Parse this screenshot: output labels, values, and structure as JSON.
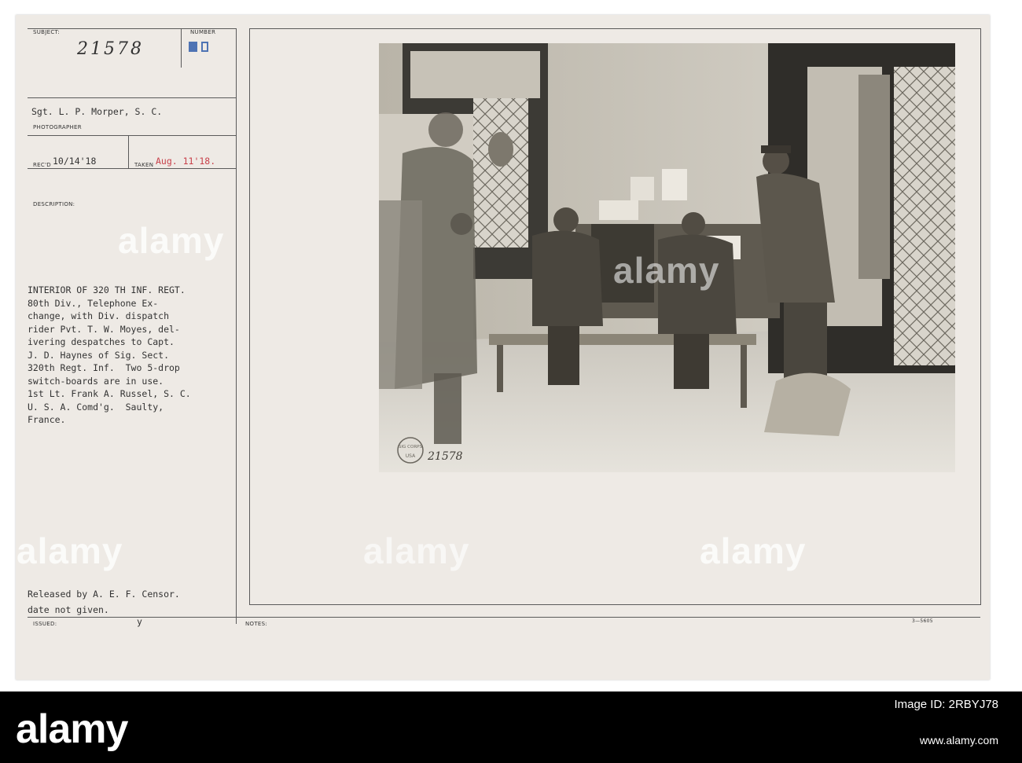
{
  "card": {
    "subject_label": "SUBJECT:",
    "number_label": "NUMBER",
    "number_value": "21578",
    "photographer": "Sgt. L. P. Morper, S. C.",
    "photographer_label": "PHOTOGRAPHER",
    "recd_label": "REC'D",
    "recd_value": "10/14'18",
    "taken_label": "TAKEN",
    "taken_value": "Aug. 11'18.",
    "description_label": "DESCRIPTION:",
    "description": "INTERIOR OF 320 TH INF. REGT.\n80th Div., Telephone Ex-\nchange, with Div. dispatch\nrider Pvt. T. W. Moyes, del-\nivering despatches to Capt.\nJ. D. Haynes of Sig. Sect.\n320th Regt. Inf.  Two 5-drop\nswitch-boards are in use.\n1st Lt. Frank A. Russel, S. C.\nU. S. A. Comd'g.  Saulty,\nFrance.",
    "released": "Released by A. E. F. Censor.",
    "date_note": "date not given.",
    "issued_label": "ISSUED:",
    "issued_mark": "y",
    "notes_label": "NOTES:",
    "form_number": "3—5605",
    "photo_stamp_number": "21578",
    "stamp_lettering": "SIG CORPS USA"
  },
  "watermarks": [
    "alamy",
    "alamy",
    "alamy",
    "alamy",
    "alamy"
  ],
  "footer": {
    "logo": "alamy",
    "image_id_label": "Image ID: 2RBYJ78",
    "url": "www.alamy.com"
  }
}
